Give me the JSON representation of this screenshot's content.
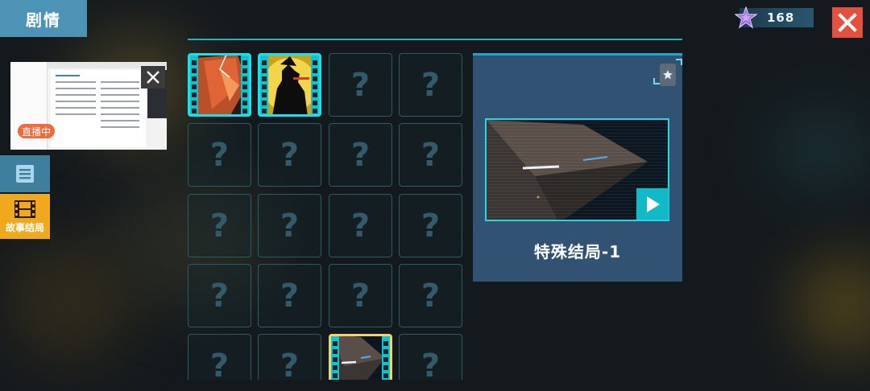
{
  "header": {
    "title": "剧情"
  },
  "currency": {
    "icon": "purple-star-icon",
    "amount": "168"
  },
  "close_icon": "close-icon",
  "live": {
    "badge": "直播中",
    "close_icon": "close-icon"
  },
  "sidebar": {
    "items": [
      {
        "icon": "document-icon",
        "label": ""
      },
      {
        "icon": "film-icon",
        "label": "故事结局"
      }
    ]
  },
  "grid": {
    "locked_glyph": "?",
    "cells": [
      {
        "state": "unlocked",
        "thumb": "red-fragment"
      },
      {
        "state": "unlocked",
        "thumb": "silhouette-yellow"
      },
      {
        "state": "locked"
      },
      {
        "state": "locked"
      },
      {
        "state": "locked"
      },
      {
        "state": "locked"
      },
      {
        "state": "locked"
      },
      {
        "state": "locked"
      },
      {
        "state": "locked"
      },
      {
        "state": "locked"
      },
      {
        "state": "locked"
      },
      {
        "state": "locked"
      },
      {
        "state": "locked"
      },
      {
        "state": "locked"
      },
      {
        "state": "locked"
      },
      {
        "state": "locked"
      },
      {
        "state": "locked"
      },
      {
        "state": "locked"
      },
      {
        "state": "selected",
        "thumb": "aircraft"
      },
      {
        "state": "locked"
      }
    ]
  },
  "detail": {
    "title": "特殊结局-1",
    "badge_icon": "star-medal-icon",
    "play_icon": "play-icon"
  },
  "colors": {
    "accent": "#1ee0ea",
    "title_tab": "#4d93b6",
    "close": "#e5503d",
    "selected_tab": "#f0a81f",
    "panel": "#315273"
  }
}
